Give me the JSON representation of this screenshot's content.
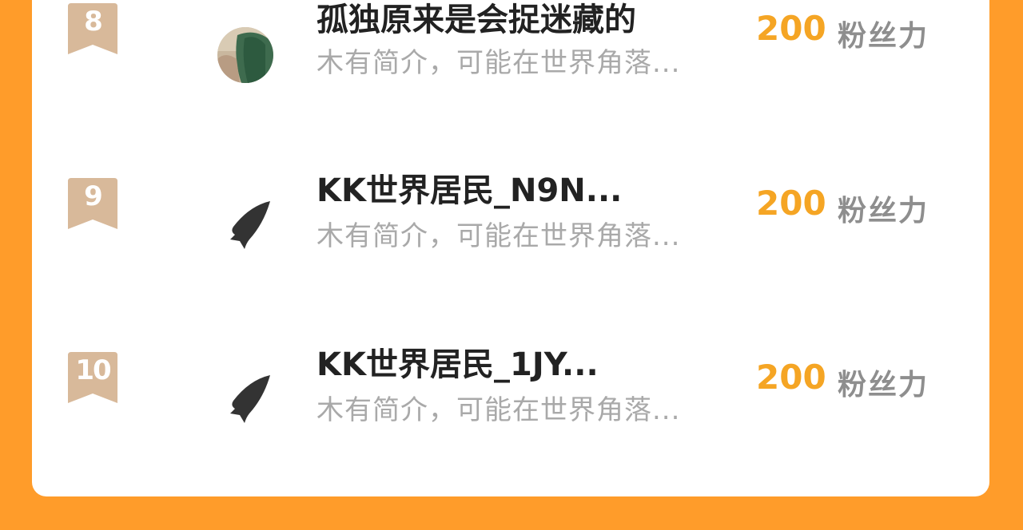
{
  "colors": {
    "background": "#FF9C2A",
    "card": "#FFFFFF",
    "rank_badge": "#D8B99A",
    "fans_value": "#F5A524",
    "fans_label": "#8E8E8E",
    "name_text": "#222222",
    "intro_text": "#A9A9A9"
  },
  "ranking": [
    {
      "rank": "8",
      "name": "孤独原来是会捉迷藏的",
      "intro": "木有简介，可能在世界角落...",
      "fans_value": "200",
      "fans_label": "粉丝力",
      "avatar_icon": "user-photo-avatar"
    },
    {
      "rank": "9",
      "name": "KK世界居民_N9N...",
      "intro": "木有简介，可能在世界角落...",
      "fans_value": "200",
      "fans_label": "粉丝力",
      "avatar_icon": "default-shark-fin-avatar"
    },
    {
      "rank": "10",
      "name": "KK世界居民_1JY...",
      "intro": "木有简介，可能在世界角落...",
      "fans_value": "200",
      "fans_label": "粉丝力",
      "avatar_icon": "default-shark-fin-avatar"
    }
  ]
}
